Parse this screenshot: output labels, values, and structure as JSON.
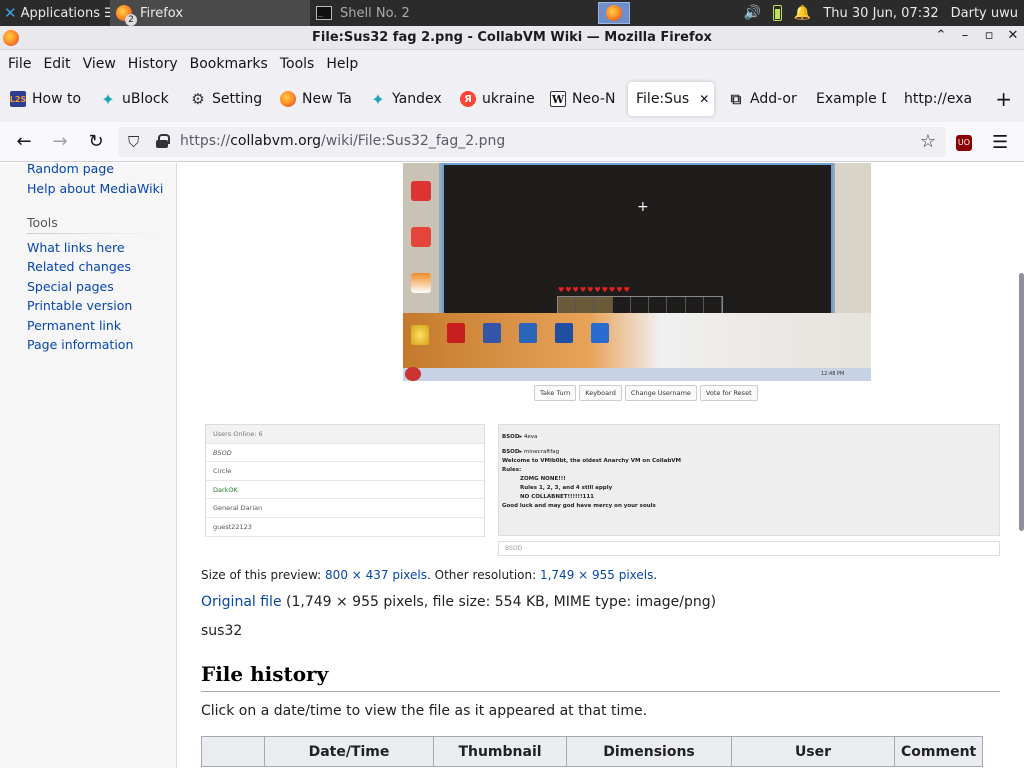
{
  "panel": {
    "applications_label": "Applications",
    "tasks": [
      {
        "label": "Firefox",
        "badge": "2"
      },
      {
        "label": "Shell No. 2"
      }
    ],
    "clock": "Thu 30 Jun, 07:32",
    "user": "Darty uwu"
  },
  "window": {
    "title": "File:Sus32 fag 2.png - CollabVM Wiki — Mozilla Firefox"
  },
  "menubar": {
    "items": [
      "File",
      "Edit",
      "View",
      "History",
      "Bookmarks",
      "Tools",
      "Help"
    ]
  },
  "tabs": [
    {
      "label": "How to",
      "icon": "l2s-icon",
      "icon_text": "L2S"
    },
    {
      "label": "uBlock",
      "icon": "ublock-icon"
    },
    {
      "label": "Setting",
      "icon": "gear-icon"
    },
    {
      "label": "New Ta",
      "icon": "firefox-icon"
    },
    {
      "label": "Yandex",
      "icon": "ublock-icon"
    },
    {
      "label": "ukraine",
      "icon": "yandex-icon",
      "icon_text": "Я"
    },
    {
      "label": "Neo-N",
      "icon": "wikipedia-icon",
      "icon_text": "W"
    },
    {
      "label": "File:Sus",
      "icon": "",
      "selected": true
    },
    {
      "label": "Add-or",
      "icon": "puzzle-icon"
    },
    {
      "label": "Example D",
      "icon": ""
    },
    {
      "label": "http://exa",
      "icon": ""
    }
  ],
  "navbar": {
    "url_prefix": "https://",
    "url_domain": "collabvm.org",
    "url_path": "/wiki/File:Sus32_fag_2.png",
    "ublock_badge": "UO"
  },
  "sidebar": {
    "nav_links": [
      "Random page",
      "Help about MediaWiki"
    ],
    "tools_heading": "Tools",
    "tools_links": [
      "What links here",
      "Related changes",
      "Special pages",
      "Printable version",
      "Permanent link",
      "Page information"
    ]
  },
  "preview": {
    "vm_buttons": [
      "Take Turn",
      "Keyboard",
      "Change Username",
      "Vote for Reset"
    ],
    "users_header": "Users Online: 6",
    "users": [
      "BSOD",
      "Circle",
      "DarkOK",
      "General Darian",
      "guest22123"
    ],
    "chat_lines": [
      {
        "name": "BSOD",
        "text": "4eva"
      },
      {
        "name": "BSOD",
        "text": "minecraftfag"
      }
    ],
    "chat_welcome": "Welcome to VMib0bt, the oldest Anarchy VM on CollabVM",
    "chat_rules_label": "Rules:",
    "chat_rules": [
      "ZOMG NONE!!!",
      "Rules 1, 2, 3, and 4 still apply",
      "NO COLLABNET!!!!!!111"
    ],
    "chat_goodluck": "Good luck and may god have mercy on your souls",
    "chat_input": "BSOD",
    "clock": "12:48 PM"
  },
  "fileinfo": {
    "size_prefix": "Size of this preview: ",
    "size_link": "800 × 437 pixels",
    "size_mid": ". Other resolution: ",
    "size_link2": "1,749 × 955 pixels",
    "size_end": ".",
    "original_link": "Original file",
    "original_details": " (1,749 × 955 pixels, file size: 554 KB, MIME type: image/png)",
    "description": "sus32"
  },
  "file_history": {
    "heading": "File history",
    "note": "Click on a date/time to view the file as it appeared at that time.",
    "columns": [
      "",
      "Date/Time",
      "Thumbnail",
      "Dimensions",
      "User",
      "Comment"
    ]
  }
}
